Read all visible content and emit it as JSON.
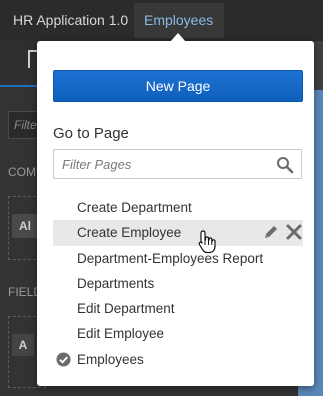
{
  "header": {
    "app_title": "HR Application 1.0",
    "current_page": "Employees"
  },
  "popover": {
    "new_page_label": "New Page",
    "goto_title": "Go to Page",
    "filter_placeholder": "Filter Pages",
    "pages": [
      {
        "label": "Create Department",
        "selected": false,
        "hovered": false
      },
      {
        "label": "Create Employee",
        "selected": false,
        "hovered": true
      },
      {
        "label": "Department-Employees Report",
        "selected": false,
        "hovered": false
      },
      {
        "label": "Departments",
        "selected": false,
        "hovered": false
      },
      {
        "label": "Edit Department",
        "selected": false,
        "hovered": false
      },
      {
        "label": "Edit Employee",
        "selected": false,
        "hovered": false
      },
      {
        "label": "Employees",
        "selected": true,
        "hovered": false
      }
    ]
  },
  "background": {
    "filter_placeholder": "Filte",
    "section_components": "COM",
    "section_fields": "FIELD",
    "chip_text": "Al",
    "chip_letter": "A"
  },
  "colors": {
    "accent": "#1a6dcc",
    "link": "#8ab9e6",
    "header_bg": "#2b2b2b"
  },
  "icons": [
    "search-icon",
    "edit-icon",
    "delete-icon",
    "check-circle-icon",
    "pointer-cursor-icon"
  ]
}
